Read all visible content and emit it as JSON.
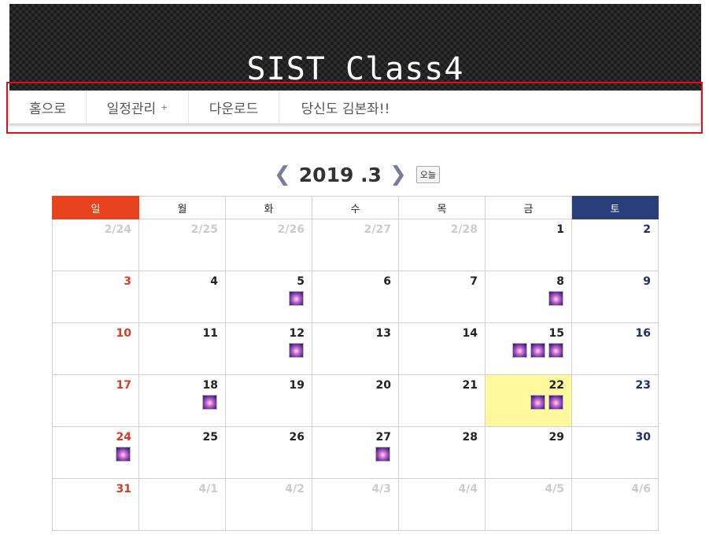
{
  "banner": {
    "title": "SIST Class4"
  },
  "nav": {
    "items": [
      {
        "label": "홈으로"
      },
      {
        "label": "일정관리",
        "caret": "+"
      },
      {
        "label": "다운로드"
      },
      {
        "label": "당신도 김본좌!!"
      }
    ]
  },
  "calendar": {
    "title": "2019 .3",
    "prev_arrow": "❮",
    "next_arrow": "❯",
    "today_label": "오늘",
    "weekdays": [
      "일",
      "월",
      "화",
      "수",
      "목",
      "금",
      "토"
    ],
    "weeks": [
      [
        {
          "d": "2/24",
          "other": true
        },
        {
          "d": "2/25",
          "other": true
        },
        {
          "d": "2/26",
          "other": true
        },
        {
          "d": "2/27",
          "other": true
        },
        {
          "d": "2/28",
          "other": true
        },
        {
          "d": "1"
        },
        {
          "d": "2"
        }
      ],
      [
        {
          "d": "3"
        },
        {
          "d": "4"
        },
        {
          "d": "5",
          "events": 1
        },
        {
          "d": "6"
        },
        {
          "d": "7"
        },
        {
          "d": "8",
          "events": 1
        },
        {
          "d": "9"
        }
      ],
      [
        {
          "d": "10"
        },
        {
          "d": "11"
        },
        {
          "d": "12",
          "events": 1
        },
        {
          "d": "13"
        },
        {
          "d": "14"
        },
        {
          "d": "15",
          "events": 3
        },
        {
          "d": "16"
        }
      ],
      [
        {
          "d": "17"
        },
        {
          "d": "18",
          "events": 1
        },
        {
          "d": "19"
        },
        {
          "d": "20"
        },
        {
          "d": "21"
        },
        {
          "d": "22",
          "events": 2,
          "today": true
        },
        {
          "d": "23"
        }
      ],
      [
        {
          "d": "24",
          "events": 1
        },
        {
          "d": "25"
        },
        {
          "d": "26"
        },
        {
          "d": "27",
          "events": 1
        },
        {
          "d": "28"
        },
        {
          "d": "29"
        },
        {
          "d": "30"
        }
      ],
      [
        {
          "d": "31"
        },
        {
          "d": "4/1",
          "other": true
        },
        {
          "d": "4/2",
          "other": true
        },
        {
          "d": "4/3",
          "other": true
        },
        {
          "d": "4/4",
          "other": true
        },
        {
          "d": "4/5",
          "other": true
        },
        {
          "d": "4/6",
          "other": true
        }
      ]
    ]
  },
  "colors": {
    "sunday_header": "#e8411e",
    "saturday_header": "#2b3e7c",
    "today_bg": "#fff89c",
    "nav_highlight": "#e0101a"
  }
}
